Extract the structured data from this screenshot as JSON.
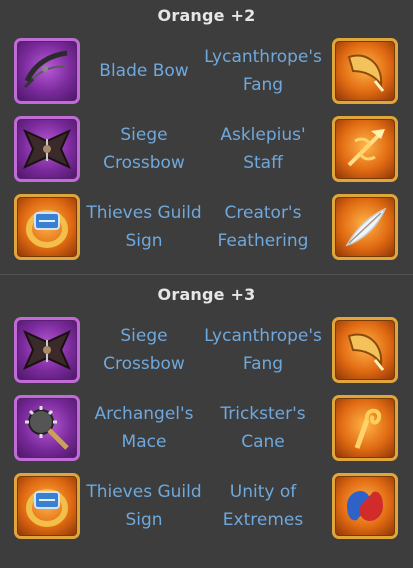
{
  "sections": [
    {
      "title": "Orange +2",
      "rows": [
        {
          "left": {
            "name": "Blade Bow",
            "icon": "blade-bow-icon"
          },
          "right": {
            "name": "Lycanthrope's Fang",
            "icon": "lycanthropes-fang-icon"
          }
        },
        {
          "left": {
            "name": "Siege Crossbow",
            "icon": "siege-crossbow-icon"
          },
          "right": {
            "name": "Asklepius' Staff",
            "icon": "asklepius-staff-icon"
          }
        },
        {
          "left": {
            "name": "Thieves Guild Sign",
            "icon": "thieves-guild-sign-icon"
          },
          "right": {
            "name": "Creator's Feathering",
            "icon": "creators-feathering-icon"
          }
        }
      ]
    },
    {
      "title": "Orange +3",
      "rows": [
        {
          "left": {
            "name": "Siege Crossbow",
            "icon": "siege-crossbow-icon"
          },
          "right": {
            "name": "Lycanthrope's Fang",
            "icon": "lycanthropes-fang-icon"
          }
        },
        {
          "left": {
            "name": "Archangel's Mace",
            "icon": "archangels-mace-icon"
          },
          "right": {
            "name": "Trickster's Cane",
            "icon": "tricksters-cane-icon"
          }
        },
        {
          "left": {
            "name": "Thieves Guild Sign",
            "icon": "thieves-guild-sign-icon"
          },
          "right": {
            "name": "Unity of Extremes",
            "icon": "unity-of-extremes-icon"
          }
        }
      ]
    }
  ],
  "colors": {
    "background": "#3d3d3d",
    "title": "#e6e6e6",
    "item_name": "#6fa8dc",
    "purple_frame": "#c06bd6",
    "orange_frame": "#e0a63a"
  }
}
